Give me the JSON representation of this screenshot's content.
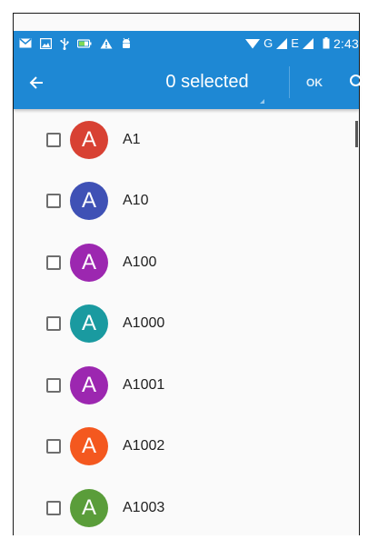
{
  "status_bar": {
    "time": "2:43",
    "network_label": "G",
    "network_label_2": "E",
    "left_icons": [
      "mail-icon",
      "image-icon",
      "usb-icon",
      "battery-saver-icon",
      "warning-icon",
      "android-debug-icon"
    ]
  },
  "app_bar": {
    "back_icon": "arrow-back-icon",
    "title": "0 selected",
    "ok_label": "OK",
    "search_icon": "search-icon",
    "color": "#1e88d4"
  },
  "contacts": [
    {
      "name": "A1",
      "initial": "A",
      "color": "#d84133"
    },
    {
      "name": "A10",
      "initial": "A",
      "color": "#3f51b5"
    },
    {
      "name": "A100",
      "initial": "A",
      "color": "#9c27b0"
    },
    {
      "name": "A1000",
      "initial": "A",
      "color": "#1a9aa0"
    },
    {
      "name": "A1001",
      "initial": "A",
      "color": "#9c27b0"
    },
    {
      "name": "A1002",
      "initial": "A",
      "color": "#f4581f"
    },
    {
      "name": "A1003",
      "initial": "A",
      "color": "#5a9d3a"
    }
  ]
}
